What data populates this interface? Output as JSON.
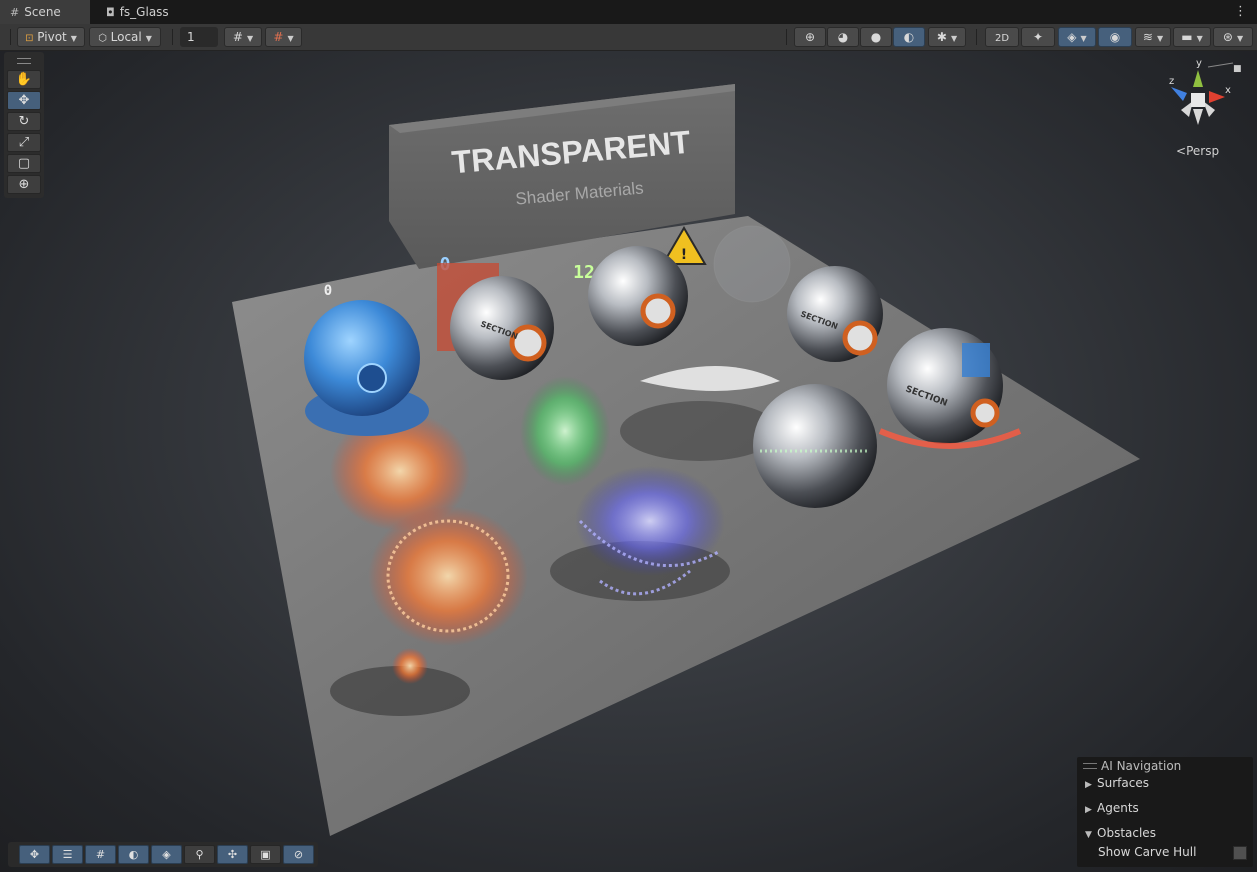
{
  "tabs": [
    {
      "label": "Scene",
      "icon": "scene-grid-icon"
    },
    {
      "label": "fs_Glass",
      "icon": "scene-asset-icon"
    }
  ],
  "toolbar": {
    "pivot": "Pivot",
    "local": "Local",
    "grid_size": "1"
  },
  "viewport": {
    "wall_title": "TRANSPARENT",
    "wall_subtitle": "Shader Materials",
    "marker_0": "0",
    "marker_12": "12",
    "marker_small": "0",
    "section_1": "SECTION",
    "section_2": "SECTION",
    "section_3": "SECTION"
  },
  "gizmo": {
    "y": "y",
    "x": "x",
    "z": "z",
    "projection": "Persp"
  },
  "ai_navigation": {
    "title": "AI Navigation",
    "items": [
      "Surfaces",
      "Agents",
      "Obstacles"
    ],
    "option": "Show Carve Hull"
  },
  "colors": {
    "accent": "#46607c",
    "panel": "#383838",
    "tab_active": "#3c3c3c"
  }
}
